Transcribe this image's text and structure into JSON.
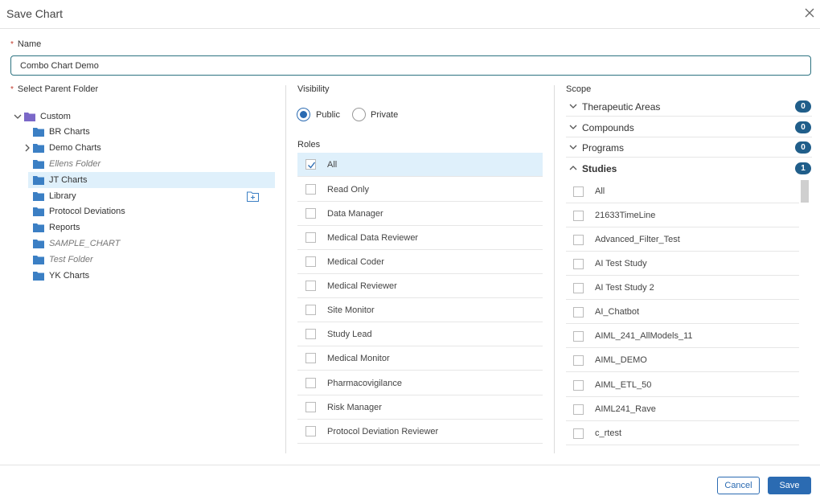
{
  "dialog": {
    "title": "Save Chart"
  },
  "name_field": {
    "label": "Name",
    "value": "Combo Chart Demo",
    "required_mark": "*"
  },
  "parent_folder": {
    "label": "Select Parent Folder",
    "required_mark": "*",
    "items": [
      {
        "label": "Custom",
        "expanded": true
      },
      {
        "label": "BR Charts"
      },
      {
        "label": "Demo Charts"
      },
      {
        "label": "Ellens Folder"
      },
      {
        "label": "JT Charts"
      },
      {
        "label": "Library"
      },
      {
        "label": "Protocol Deviations"
      },
      {
        "label": "Reports"
      },
      {
        "label": "SAMPLE_CHART"
      },
      {
        "label": "Test Folder"
      },
      {
        "label": "YK Charts"
      }
    ],
    "selected": "JT Charts"
  },
  "visibility": {
    "label": "Visibility",
    "options": [
      "Public",
      "Private"
    ],
    "selected": "Public"
  },
  "roles": {
    "label": "Roles",
    "items": [
      "All",
      "Read Only",
      "Data Manager",
      "Medical Data Reviewer",
      "Medical Coder",
      "Medical Reviewer",
      "Site Monitor",
      "Study Lead",
      "Medical Monitor",
      "Pharmacovigilance",
      "Risk Manager",
      "Protocol Deviation Reviewer"
    ],
    "checked": [
      "All"
    ]
  },
  "scope": {
    "label": "Scope",
    "sections": [
      {
        "label": "Therapeutic Areas",
        "count": "0",
        "expanded": false
      },
      {
        "label": "Compounds",
        "count": "0",
        "expanded": false
      },
      {
        "label": "Programs",
        "count": "0",
        "expanded": false
      },
      {
        "label": "Studies",
        "count": "1",
        "expanded": true
      }
    ],
    "studies": [
      "All",
      "21633TimeLine",
      "Advanced_Filter_Test",
      "AI Test Study",
      "AI Test Study 2",
      "AI_Chatbot",
      "AIML_241_AllModels_11",
      "AIML_DEMO",
      "AIML_ETL_50",
      "AIML241_Rave",
      "c_rtest"
    ]
  },
  "footer": {
    "cancel_label": "Cancel",
    "save_label": "Save"
  },
  "colors": {
    "accent": "#2b6bb2",
    "badge": "#205e8a",
    "selected_row": "#dff0fb",
    "folder": "#3b7fc4",
    "root_folder": "#7b68c8"
  }
}
